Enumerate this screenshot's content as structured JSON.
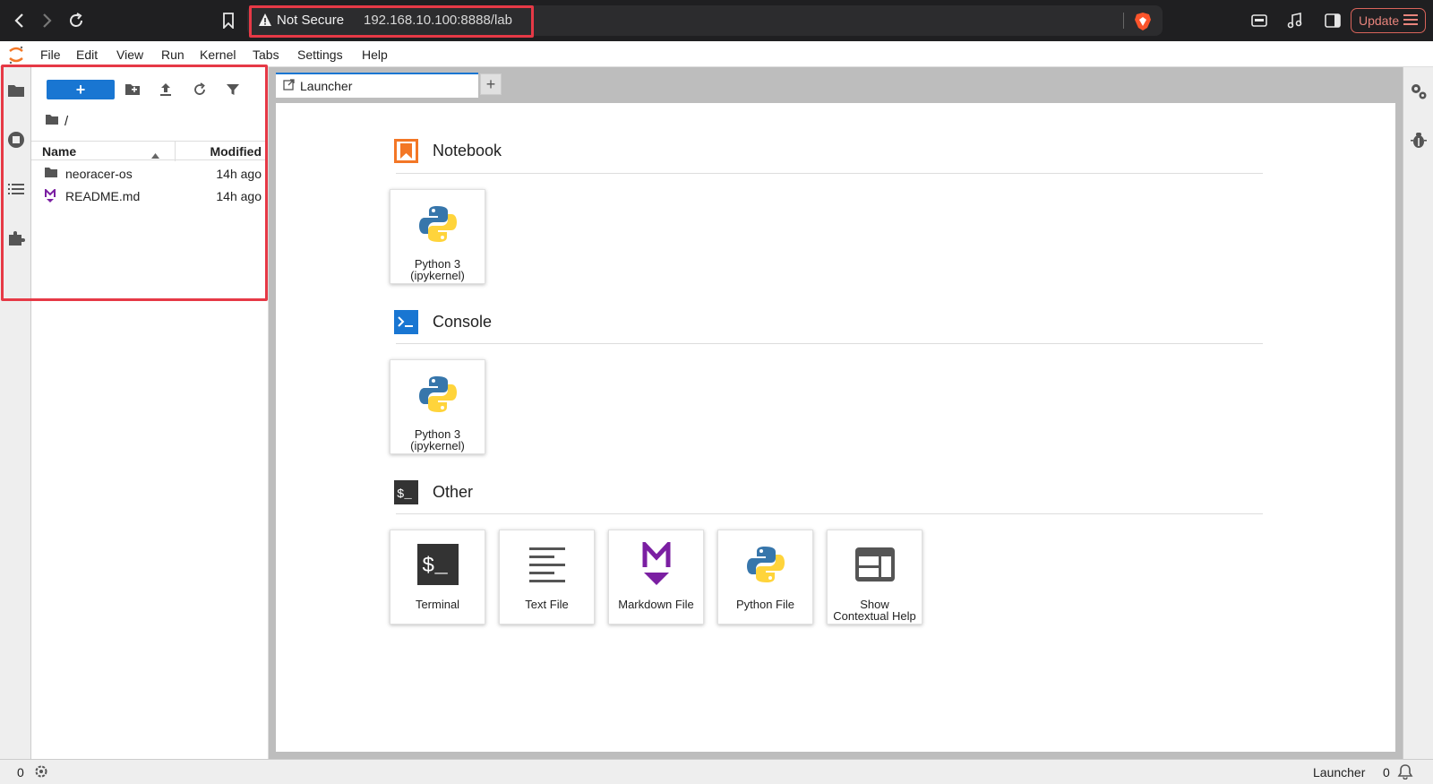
{
  "browser": {
    "security_label": "Not Secure",
    "url": "192.168.10.100:8888/lab",
    "update_label": "Update"
  },
  "menu": [
    "File",
    "Edit",
    "View",
    "Run",
    "Kernel",
    "Tabs",
    "Settings",
    "Help"
  ],
  "filebrowser": {
    "new_label": "+",
    "path": "/",
    "columns": {
      "name": "Name",
      "modified": "Modified"
    },
    "files": [
      {
        "name": "neoracer-os",
        "modified": "14h ago",
        "type": "folder"
      },
      {
        "name": "README.md",
        "modified": "14h ago",
        "type": "markdown"
      }
    ]
  },
  "tabs": [
    {
      "label": "Launcher"
    }
  ],
  "tab_add": "+",
  "launcher": {
    "sections": [
      {
        "title": "Notebook",
        "items": [
          {
            "label": "Python 3\n(ipykernel)"
          }
        ]
      },
      {
        "title": "Console",
        "items": [
          {
            "label": "Python 3\n(ipykernel)"
          }
        ]
      },
      {
        "title": "Other",
        "items": [
          {
            "label": "Terminal"
          },
          {
            "label": "Text File"
          },
          {
            "label": "Markdown File"
          },
          {
            "label": "Python File"
          },
          {
            "label": "Show\nContextual Help"
          }
        ]
      }
    ]
  },
  "statusbar": {
    "left_count": "0",
    "right_label": "Launcher",
    "right_count": "0"
  },
  "colors": {
    "accent": "#1976d2",
    "highlight": "#e63946",
    "notebook": "#f37726",
    "markdown": "#7b1fa2"
  }
}
